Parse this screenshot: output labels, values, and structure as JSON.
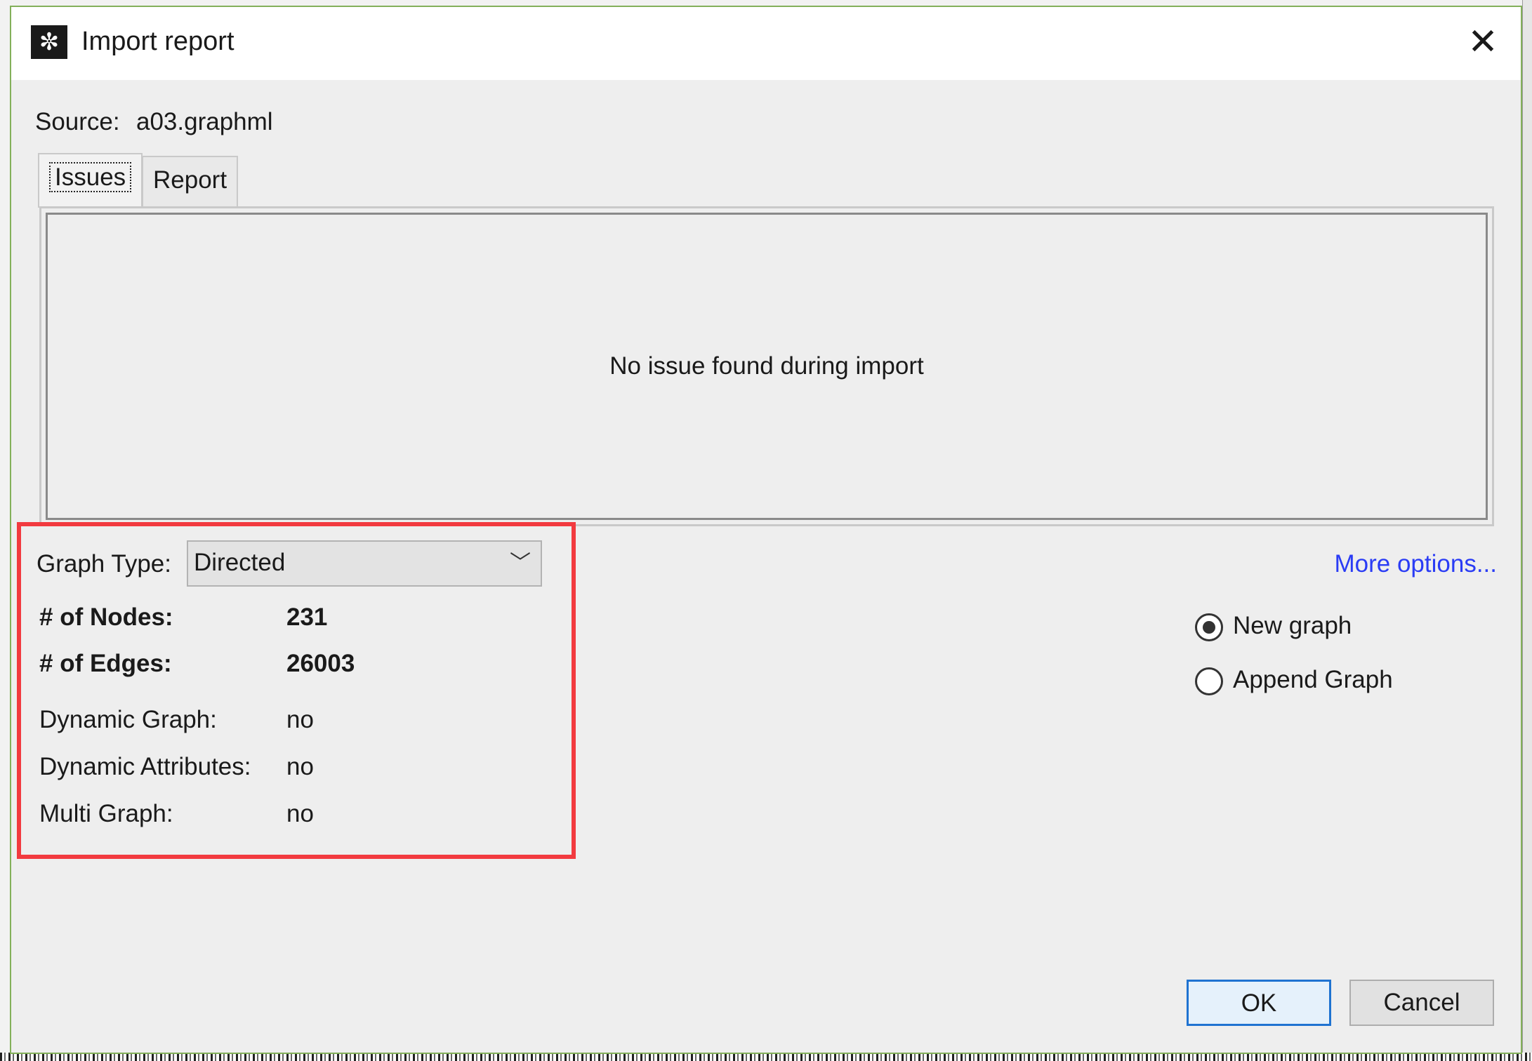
{
  "dialog": {
    "title": "Import report",
    "close_glyph": "✕",
    "app_icon_glyph": "✼"
  },
  "source": {
    "label": "Source:",
    "value": "a03.graphml"
  },
  "tabs": [
    {
      "label": "Issues",
      "active": true
    },
    {
      "label": "Report",
      "active": false
    }
  ],
  "issues_panel": {
    "message": "No issue found during import"
  },
  "graph_type": {
    "label": "Graph Type:",
    "selected": "Directed",
    "chevron_glyph": "﹀"
  },
  "stats": {
    "nodes_label": "# of Nodes:",
    "nodes_value": "231",
    "edges_label": "# of Edges:",
    "edges_value": "26003",
    "dynamic_graph_label": "Dynamic Graph:",
    "dynamic_graph_value": "no",
    "dynamic_attributes_label": "Dynamic Attributes:",
    "dynamic_attributes_value": "no",
    "multi_graph_label": "Multi Graph:",
    "multi_graph_value": "no"
  },
  "more_options": "More options...",
  "mode": {
    "new_graph": "New graph",
    "append_graph": "Append Graph",
    "selected": "new_graph"
  },
  "buttons": {
    "ok": "OK",
    "cancel": "Cancel"
  },
  "colors": {
    "highlight": "#f23a3f",
    "link": "#2a3cf5",
    "dialog_border": "#83b05a",
    "default_button_border": "#1f73d1"
  }
}
